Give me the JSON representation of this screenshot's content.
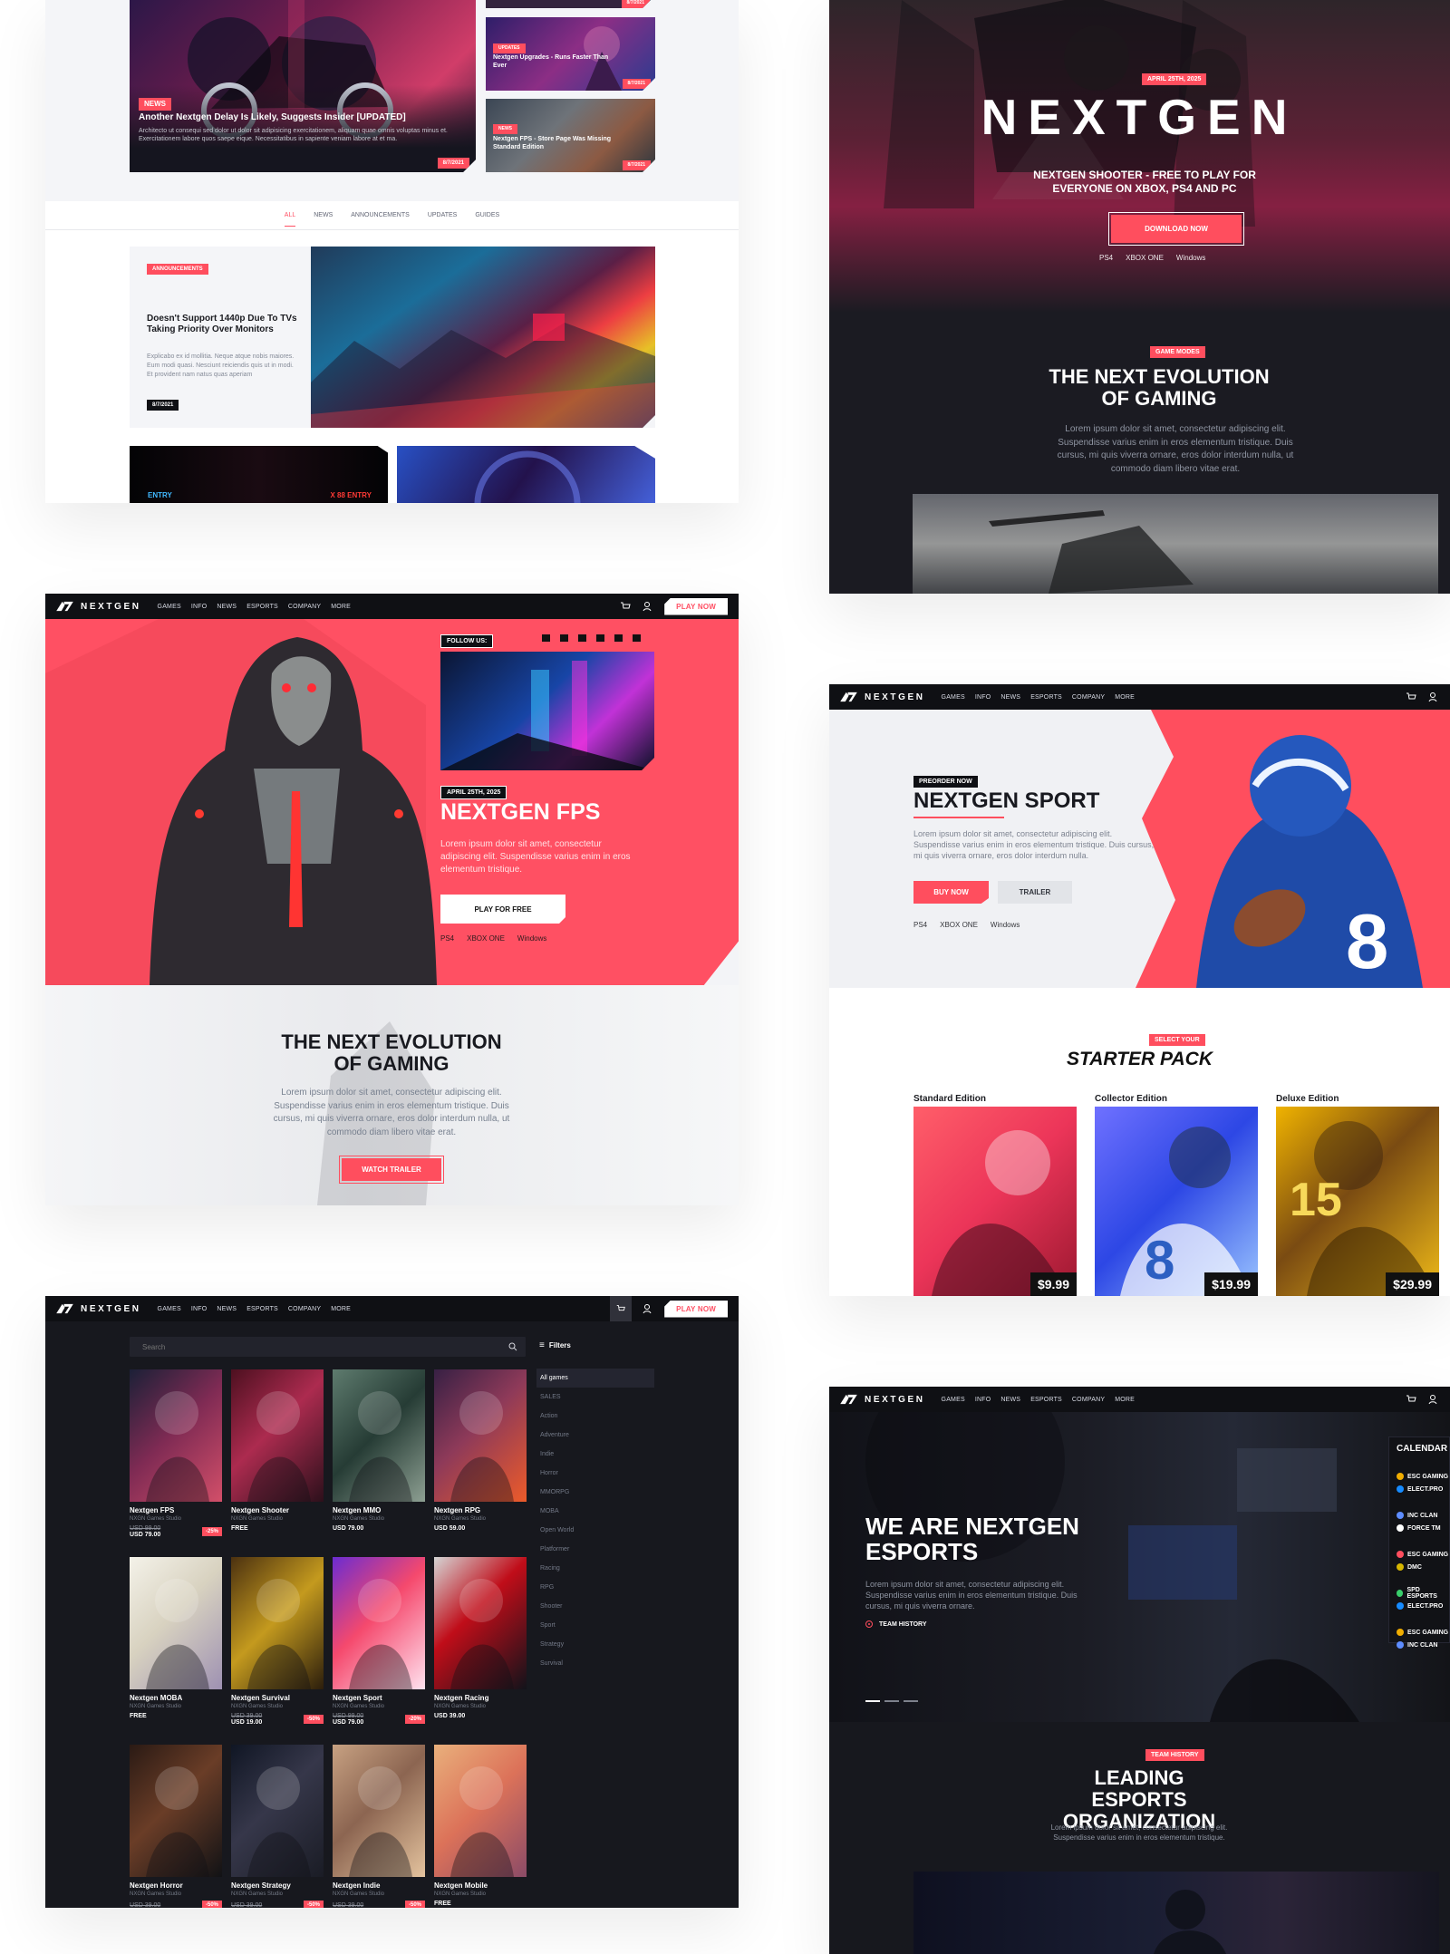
{
  "brand": {
    "name": "NEXTGEN",
    "colors": {
      "accent": "#ff4e5e",
      "dark": "#17181e",
      "light": "#f4f5f8"
    }
  },
  "nav": {
    "items": [
      "GAMES",
      "INFO",
      "NEWS",
      "ESPORTS",
      "COMPANY",
      "MORE"
    ],
    "play_now": "PLAY NOW"
  },
  "panel_news": {
    "headline": "Another Nextgen Delay Is Likely, Suggests Insider [UPDATED]",
    "headline_tag": "NEWS",
    "headline_excerpt": "Architecto ut consequi sed dolor ut dolor sit adipisicing exercitationem, aliquam quae omnis voluptas minus et. Exercitationem labore quos saepe eique. Necessitatibus in sapiente veniam labore at et ma.",
    "headline_date": "8/7/2021",
    "side_stories": [
      {
        "tag": "",
        "title": "",
        "date": "8/7/2021"
      },
      {
        "tag": "UPDATES",
        "title": "Nextgen Upgrades - Runs Faster Than Ever",
        "date": "8/7/2021"
      },
      {
        "tag": "NEWS",
        "title": "Nextgen FPS - Store Page Was Missing Standard Edition",
        "date": "8/7/2021"
      }
    ],
    "tabs": [
      "ALL",
      "NEWS",
      "ANNOUNCEMENTS",
      "UPDATES",
      "GUIDES"
    ],
    "feature_tag": "ANNOUNCEMENTS",
    "feature_title": "Doesn't Support 1440p Due To TVs Taking Priority Over Monitors",
    "feature_body": "Explicabo ex id mollitia. Neque atque nobis maiores. Eum modi quasi. Nesciunt reiciendis quis ut in modi. Et provident nam natus quas aperiam",
    "feature_date": "8/7/2021"
  },
  "panel_shooter": {
    "date_tag": "APRIL 25TH, 2025",
    "logo_text": "NEXTGEN",
    "subtitle": "NEXTGEN SHOOTER - FREE TO PLAY FOR EVERYONE ON XBOX, PS4 AND PC",
    "download": "DOWNLOAD NOW",
    "platforms": [
      "PS4",
      "XBOX ONE",
      "Windows"
    ],
    "mode_tag": "GAME MODES",
    "evolution_title": "THE NEXT EVOLUTION OF GAMING",
    "evolution_body": "Lorem ipsum dolor sit amet, consectetur adipiscing elit. Suspendisse varius enim in eros elementum tristique. Duis cursus, mi quis viverra ornare, eros dolor interdum nulla, ut commodo diam libero vitae erat."
  },
  "panel_fps": {
    "follow": "FOLLOW US:",
    "date_tag": "APRIL 25TH, 2025",
    "title": "NEXTGEN FPS",
    "body": "Lorem ipsum dolor sit amet, consectetur adipiscing elit. Suspendisse varius enim in eros elementum tristique.",
    "play": "PLAY FOR FREE",
    "platforms": [
      "PS4",
      "XBOX ONE",
      "Windows"
    ],
    "evolution_title": "THE NEXT EVOLUTION OF GAMING",
    "evolution_body": "Lorem ipsum dolor sit amet, consectetur adipiscing elit. Suspendisse varius enim in eros elementum tristique. Duis cursus, mi quis viverra ornare, eros dolor interdum nulla, ut commodo diam libero vitae erat.",
    "trailer": "WATCH TRAILER"
  },
  "panel_sport": {
    "preorder_tag": "PREORDER NOW",
    "title": "NEXTGEN SPORT",
    "body": "Lorem ipsum dolor sit amet, consectetur adipiscing elit. Suspendisse varius enim in eros elementum tristique. Duis cursus, mi quis viverra ornare, eros dolor interdum nulla.",
    "buy": "BUY NOW",
    "trailer": "TRAILER",
    "platforms": [
      "PS4",
      "XBOX ONE",
      "Windows"
    ],
    "select_tag": "SELECT YOUR",
    "starter_title": "STARTER PACK",
    "editions": [
      {
        "name": "Standard Edition",
        "price": "$9.99"
      },
      {
        "name": "Collector Edition",
        "price": "$19.99"
      },
      {
        "name": "Deluxe Edition",
        "price": "$29.99"
      }
    ]
  },
  "panel_store": {
    "search_placeholder": "Search",
    "filters": "Filters",
    "categories": [
      "All games",
      "SALES",
      "Action",
      "Adventure",
      "Indie",
      "Horror",
      "MMORPG",
      "MOBA",
      "Open World",
      "Platformer",
      "Racing",
      "RPG",
      "Shooter",
      "Sport",
      "Strategy",
      "Survival"
    ],
    "products": [
      {
        "name": "Nextgen FPS",
        "studio": "NXGN Games Studio",
        "old": "USD 99.00",
        "price": "USD 79.00",
        "discount": "-25%"
      },
      {
        "name": "Nextgen Shooter",
        "studio": "NXGN Games Studio",
        "old": "",
        "price": "FREE",
        "discount": ""
      },
      {
        "name": "Nextgen MMO",
        "studio": "NXGN Games Studio",
        "old": "",
        "price": "USD 79.00",
        "discount": ""
      },
      {
        "name": "Nextgen RPG",
        "studio": "NXGN Games Studio",
        "old": "",
        "price": "USD 59.00",
        "discount": ""
      },
      {
        "name": "Nextgen MOBA",
        "studio": "NXGN Games Studio",
        "old": "",
        "price": "FREE",
        "discount": ""
      },
      {
        "name": "Nextgen Survival",
        "studio": "NXGN Games Studio",
        "old": "USD 39.00",
        "price": "USD 19.00",
        "discount": "-50%"
      },
      {
        "name": "Nextgen Sport",
        "studio": "NXGN Games Studio",
        "old": "USD 99.00",
        "price": "USD 79.00",
        "discount": "-20%"
      },
      {
        "name": "Nextgen Racing",
        "studio": "NXGN Games Studio",
        "old": "",
        "price": "USD 39.00",
        "discount": ""
      },
      {
        "name": "Nextgen Horror",
        "studio": "NXGN Games Studio",
        "old": "USD 39.00",
        "price": "",
        "discount": "-50%"
      },
      {
        "name": "Nextgen Strategy",
        "studio": "NXGN Games Studio",
        "old": "USD 39.00",
        "price": "",
        "discount": "-50%"
      },
      {
        "name": "Nextgen Indie",
        "studio": "NXGN Games Studio",
        "old": "USD 39.00",
        "price": "",
        "discount": "-50%"
      },
      {
        "name": "Nextgen Mobile",
        "studio": "NXGN Games Studio",
        "old": "",
        "price": "FREE",
        "discount": ""
      }
    ]
  },
  "panel_esports": {
    "title": "WE ARE NEXTGEN ESPORTS",
    "body": "Lorem ipsum dolor sit amet, consectetur adipiscing elit. Suspendisse varius enim in eros elementum tristique. Duis cursus, mi quis viverra ornare.",
    "history_link": "TEAM HISTORY",
    "calendar": "CALENDAR",
    "matches": [
      [
        "ESC GAMING",
        "ELECT.PRO"
      ],
      [
        "INC CLAN",
        "FORCE TM"
      ],
      [
        "ESC GAMING",
        "DMC"
      ],
      [
        "SPD ESPORTS",
        "ELECT.PRO"
      ],
      [
        "ESC GAMING",
        "INC CLAN"
      ]
    ],
    "history_tag": "TEAM HISTORY",
    "leading_title": "LEADING ESPORTS ORGANIZATION",
    "leading_body": "Lorem ipsum dolor sit amet, consectetur adipiscing elit. Suspendisse varius enim in eros elementum tristique."
  }
}
